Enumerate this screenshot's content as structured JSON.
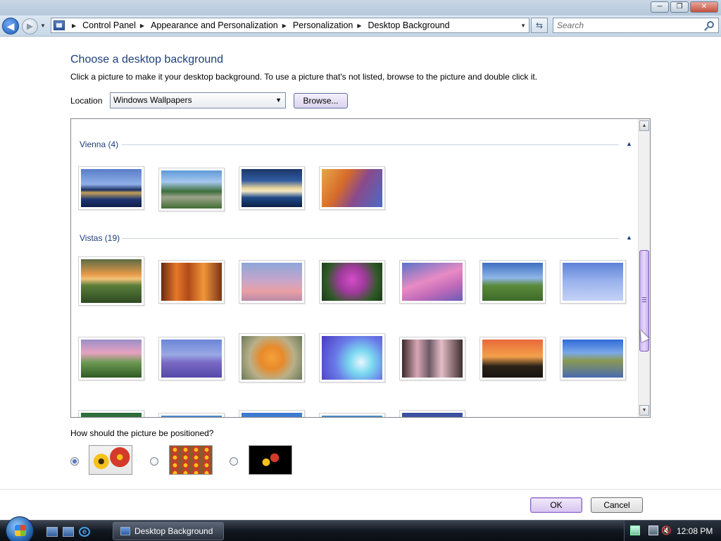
{
  "window": {
    "controls": {
      "minimize": "─",
      "maximize": "❐",
      "close": "✕"
    }
  },
  "nav": {
    "back": "◀",
    "forward": "▶",
    "breadcrumbs": [
      "Control Panel",
      "Appearance and Personalization",
      "Personalization",
      "Desktop Background"
    ],
    "search_placeholder": "Search"
  },
  "main": {
    "title": "Choose a desktop background",
    "description": "Click a picture to make it your desktop background. To use a picture that's not listed, browse to the picture and double click it.",
    "location_label": "Location",
    "location_value": "Windows Wallpapers",
    "browse_label": "Browse...",
    "groups": [
      {
        "label": "Vienna (4)",
        "thumbnails": [
          {
            "kind": "vienna-palace"
          },
          {
            "kind": "vienna-city"
          },
          {
            "kind": "vienna-church"
          },
          {
            "kind": "vienna-autumn"
          }
        ]
      },
      {
        "label": "Vistas (19)",
        "thumbnails": [
          {
            "kind": "tree-sunset"
          },
          {
            "kind": "window-orange"
          },
          {
            "kind": "bare-tree-dusk"
          },
          {
            "kind": "purple-flowers"
          },
          {
            "kind": "pink-clouds"
          },
          {
            "kind": "green-hills"
          },
          {
            "kind": "blue-branches"
          },
          {
            "kind": "wheat-field"
          },
          {
            "kind": "purple-water"
          },
          {
            "kind": "orange-flower"
          },
          {
            "kind": "light-rays"
          },
          {
            "kind": "pier-sunset"
          },
          {
            "kind": "orange-sky"
          },
          {
            "kind": "lake-trees"
          },
          {
            "kind": "green-leaf"
          },
          {
            "kind": "blue-sky-a"
          },
          {
            "kind": "blue-sky-b"
          },
          {
            "kind": "blue-sky-c"
          },
          {
            "kind": "dusk-sky"
          }
        ]
      }
    ],
    "position_question": "How should the picture be positioned?",
    "position_options": [
      {
        "name": "fit-to-screen",
        "selected": true
      },
      {
        "name": "tile",
        "selected": false
      },
      {
        "name": "center",
        "selected": false
      }
    ],
    "ok_label": "OK",
    "cancel_label": "Cancel"
  },
  "taskbar": {
    "task_label": "Desktop Background",
    "clock": "12:08 PM"
  },
  "icons": {
    "back": "back-arrow-icon",
    "forward": "forward-arrow-icon",
    "control_panel": "control-panel-icon",
    "refresh": "refresh-icon",
    "search": "search-icon",
    "collapse": "collapse-chevron-icon"
  }
}
